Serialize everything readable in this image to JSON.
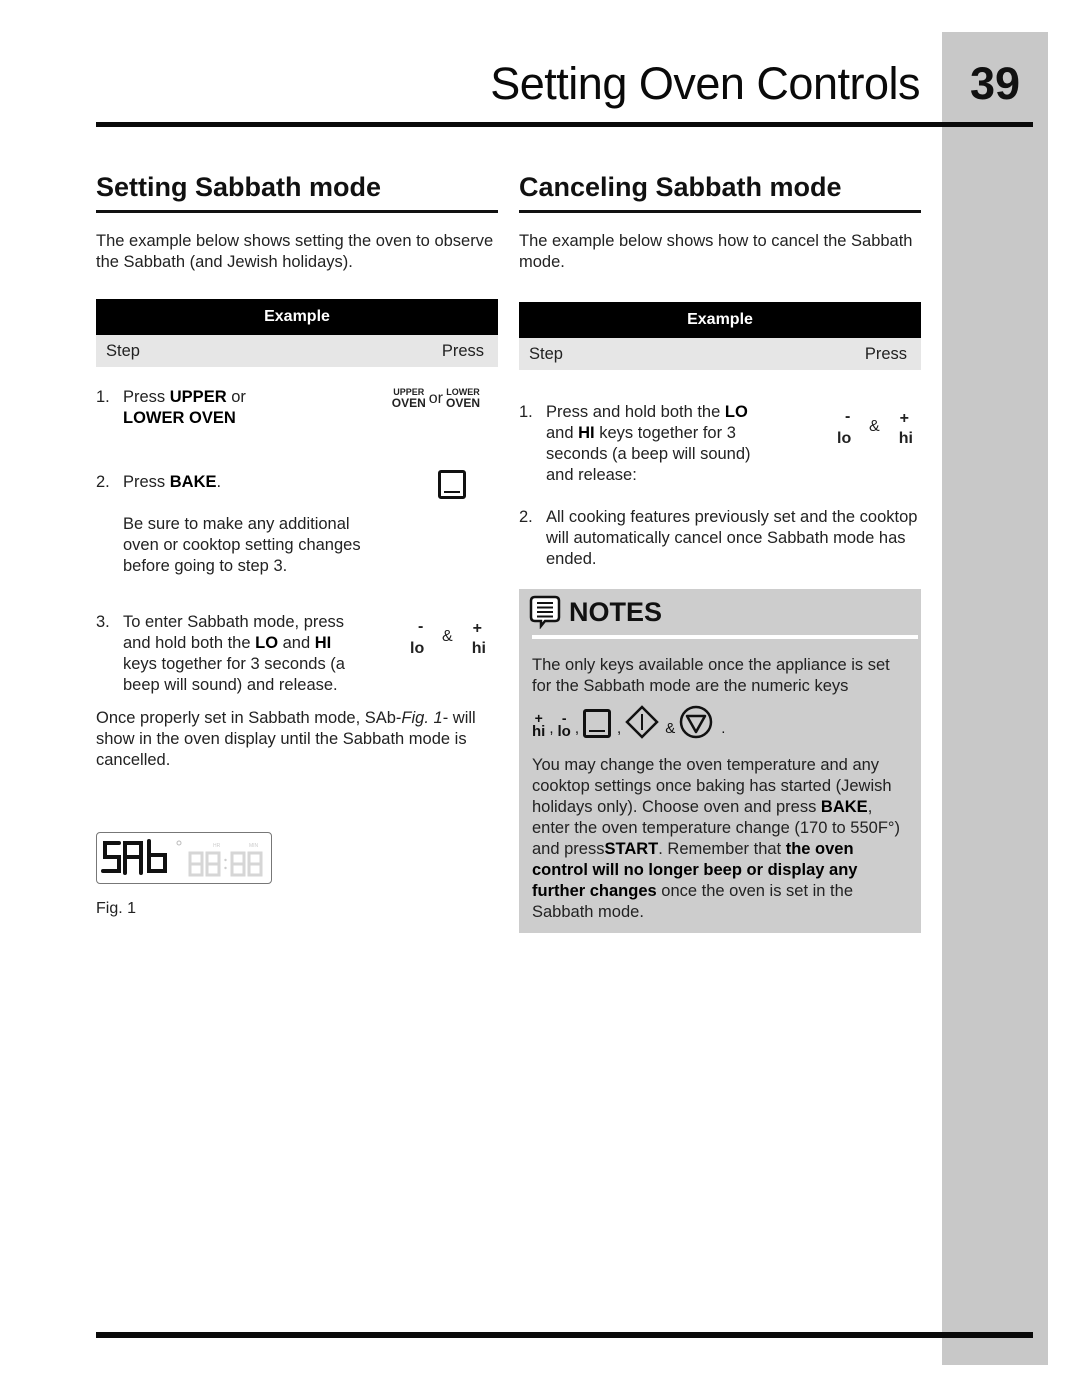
{
  "header": {
    "title": "Setting Oven Controls",
    "page_number": "39"
  },
  "setting": {
    "title": "Setting Sabbath mode",
    "intro": "The example below shows setting the oven to observe the Sabbath (and Jewish holidays).",
    "example_label": "Example",
    "col_step": "Step",
    "col_press": "Press",
    "steps": [
      {
        "num": "1.",
        "text_a": "Press ",
        "bold_a": "UPPER",
        "text_b": " or",
        "bold_b": "LOWER OVEN",
        "press": {
          "key1_small": "UPPER",
          "key1_big": "OVEN",
          "or": "or",
          "key2_small": "LOWER",
          "key2_big": "OVEN"
        }
      },
      {
        "num": "2.",
        "text_a": "Press ",
        "bold_a": "BAKE",
        "text_b": ".",
        "note": "Be sure to make any additional oven or cooktop setting changes before going to step 3.",
        "press_icon": "bake-key-icon"
      },
      {
        "num": "3.",
        "text_a": "To enter Sabbath mode, press and hold both the ",
        "bold_a": "LO",
        "text_b": " and ",
        "bold_b": "HI",
        "text_c": " keys together for 3 seconds (a beep will sound) and release.",
        "press": {
          "minus": "-",
          "lo": "lo",
          "amp": "&",
          "plus": "+",
          "hi": "hi"
        }
      }
    ],
    "after_text_a": "Once properly set in Sabbath mode, SAb-",
    "after_italic": "Fig. 1",
    "after_text_b": "- will show in the oven display until the Sabbath mode is cancelled.",
    "display": {
      "main": "SAb",
      "hr_label": "HR",
      "min_label": "MIN",
      "time": "88:88"
    },
    "fig_caption": "Fig. 1"
  },
  "canceling": {
    "title": "Canceling Sabbath mode",
    "intro": "The example below shows how to cancel the Sabbath mode.",
    "example_label": "Example",
    "col_step": "Step",
    "col_press": "Press",
    "steps": [
      {
        "num": "1.",
        "text_a": "Press and hold both the ",
        "bold_a": "LO",
        "text_b": " and ",
        "bold_b": "HI",
        "text_c": " keys together for 3 seconds (a beep will sound) and release:",
        "press": {
          "minus": "-",
          "lo": "lo",
          "amp": "&",
          "plus": "+",
          "hi": "hi"
        }
      },
      {
        "num": "2.",
        "text": "All cooking features previously set and the cooktop will automatically cancel once Sabbath mode has ended."
      }
    ]
  },
  "notes": {
    "title": "NOTES",
    "para1": "The only keys available once the appliance is set for the Sabbath mode are the numeric keys",
    "keys": {
      "plus": "+",
      "hi": "hi",
      "minus": "-",
      "lo": "lo",
      "comma": ",",
      "amp": "&",
      "period": "."
    },
    "para2_a": "You may change the oven temperature and any cooktop settings once baking has started (Jewish holidays only). Choose oven and press ",
    "para2_bake": "BAKE",
    "para2_b": ", enter the oven temperature change (170 to 550F°) and press",
    "para2_start": "START",
    "para2_c": ". Remember that ",
    "para2_bold": "the oven control will no longer beep or display any further changes",
    "para2_d": " once the oven is set in the Sabbath mode."
  }
}
